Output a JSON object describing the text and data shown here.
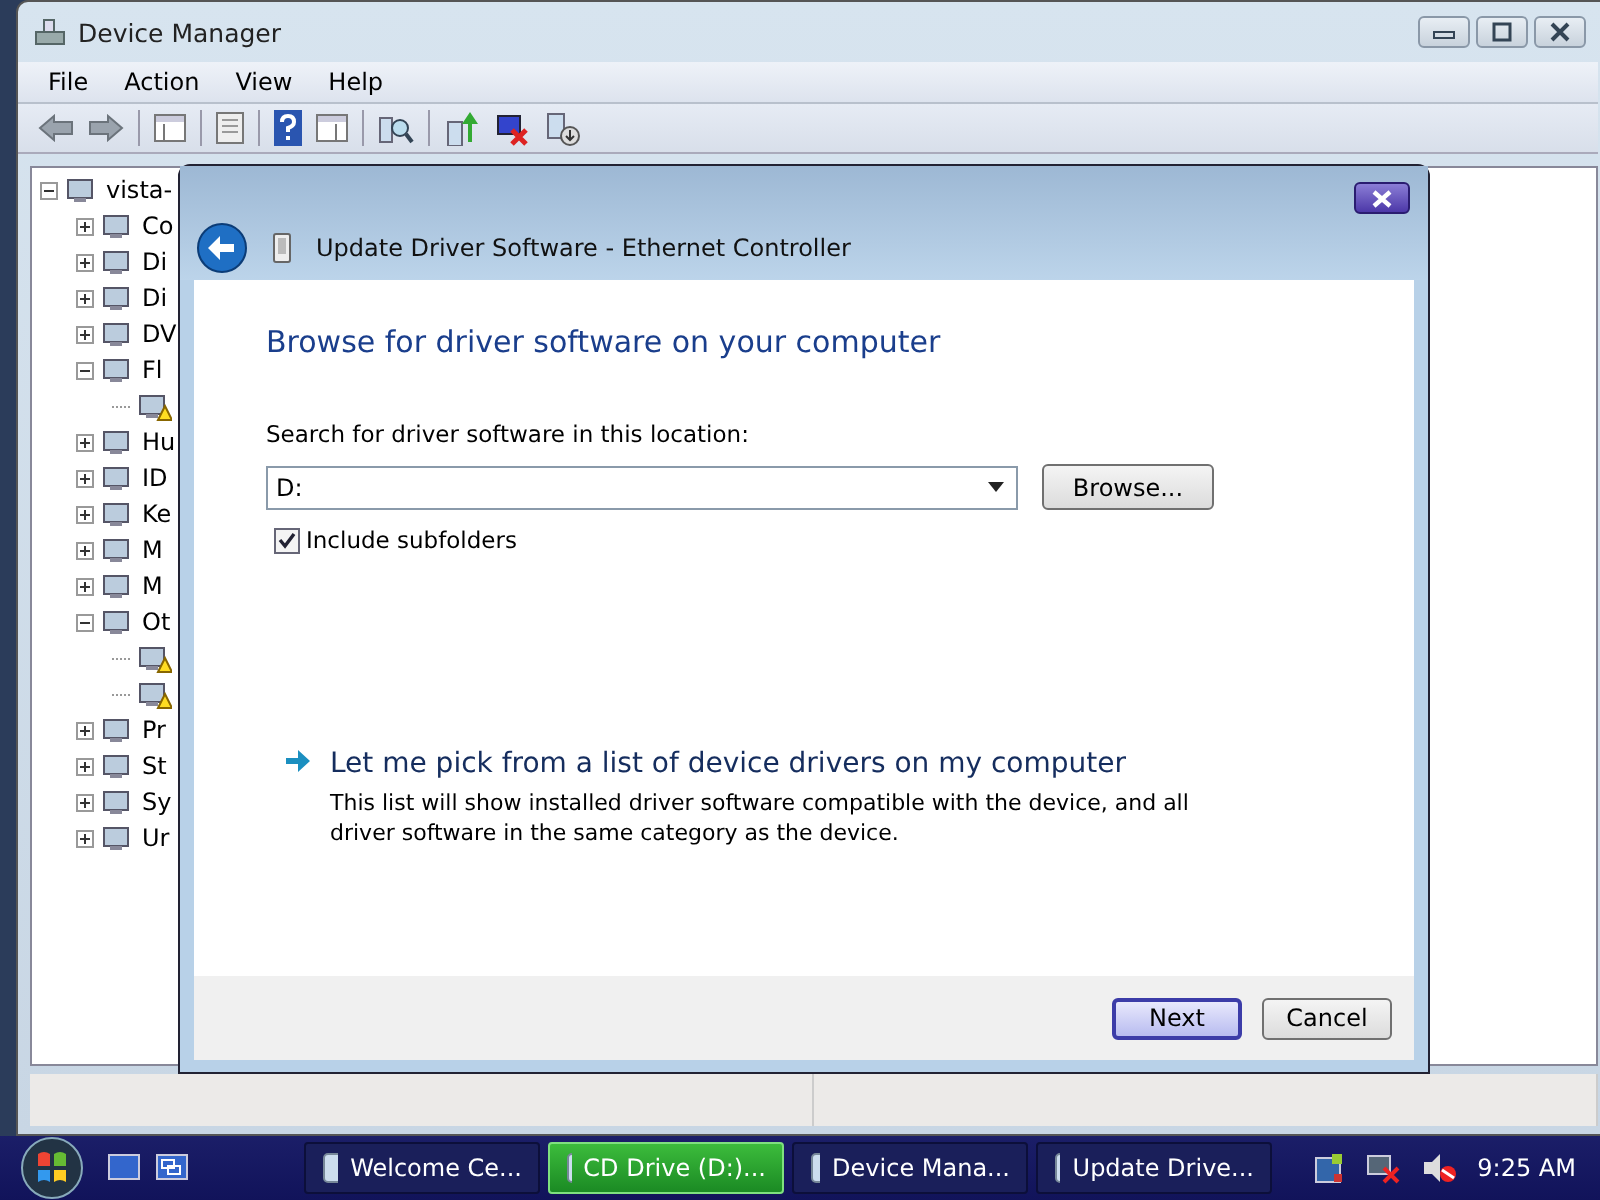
{
  "window": {
    "title": "Device Manager"
  },
  "menu": [
    "File",
    "Action",
    "View",
    "Help"
  ],
  "tree": [
    {
      "label": "vista-",
      "expanded": true,
      "children": [
        {
          "label": "Co",
          "expanded": false
        },
        {
          "label": "Di",
          "expanded": false
        },
        {
          "label": "Di",
          "expanded": false
        },
        {
          "label": "DV",
          "expanded": false
        },
        {
          "label": "Fl",
          "expanded": true,
          "children": [
            {
              "warning": true
            }
          ]
        },
        {
          "label": "Hu",
          "expanded": false
        },
        {
          "label": "ID",
          "expanded": false
        },
        {
          "label": "Ke",
          "expanded": false
        },
        {
          "label": "M",
          "expanded": false
        },
        {
          "label": "M",
          "expanded": false
        },
        {
          "label": "Ot",
          "expanded": true,
          "children": [
            {
              "warning": true
            },
            {
              "warning": true
            }
          ]
        },
        {
          "label": "Pr",
          "expanded": false
        },
        {
          "label": "St",
          "expanded": false
        },
        {
          "label": "Sy",
          "expanded": false
        },
        {
          "label": "Ur",
          "expanded": false
        }
      ]
    }
  ],
  "dialog": {
    "title": "Update Driver Software - Ethernet Controller",
    "heading": "Browse for driver software on your computer",
    "search_label": "Search for driver software in this location:",
    "location": {
      "value": "D:"
    },
    "browse_button": "Browse...",
    "include_subfolders": {
      "label": "Include subfolders",
      "checked": true
    },
    "pick_link": {
      "label": "Let me pick from a list of device drivers on my computer",
      "description": "This list will show installed driver software compatible with the device, and all driver software in the same category as the device."
    },
    "buttons": [
      {
        "label": "Next",
        "default": true
      },
      {
        "label": "Cancel",
        "default": false
      }
    ]
  },
  "taskbar": {
    "tasks": [
      {
        "label": "Welcome Ce...",
        "selected": false
      },
      {
        "label": "CD Drive (D:)...",
        "selected": true
      },
      {
        "label": "Device Mana...",
        "selected": false
      },
      {
        "label": "Update Drive...",
        "selected": false
      }
    ],
    "clock": "9:25 AM"
  }
}
